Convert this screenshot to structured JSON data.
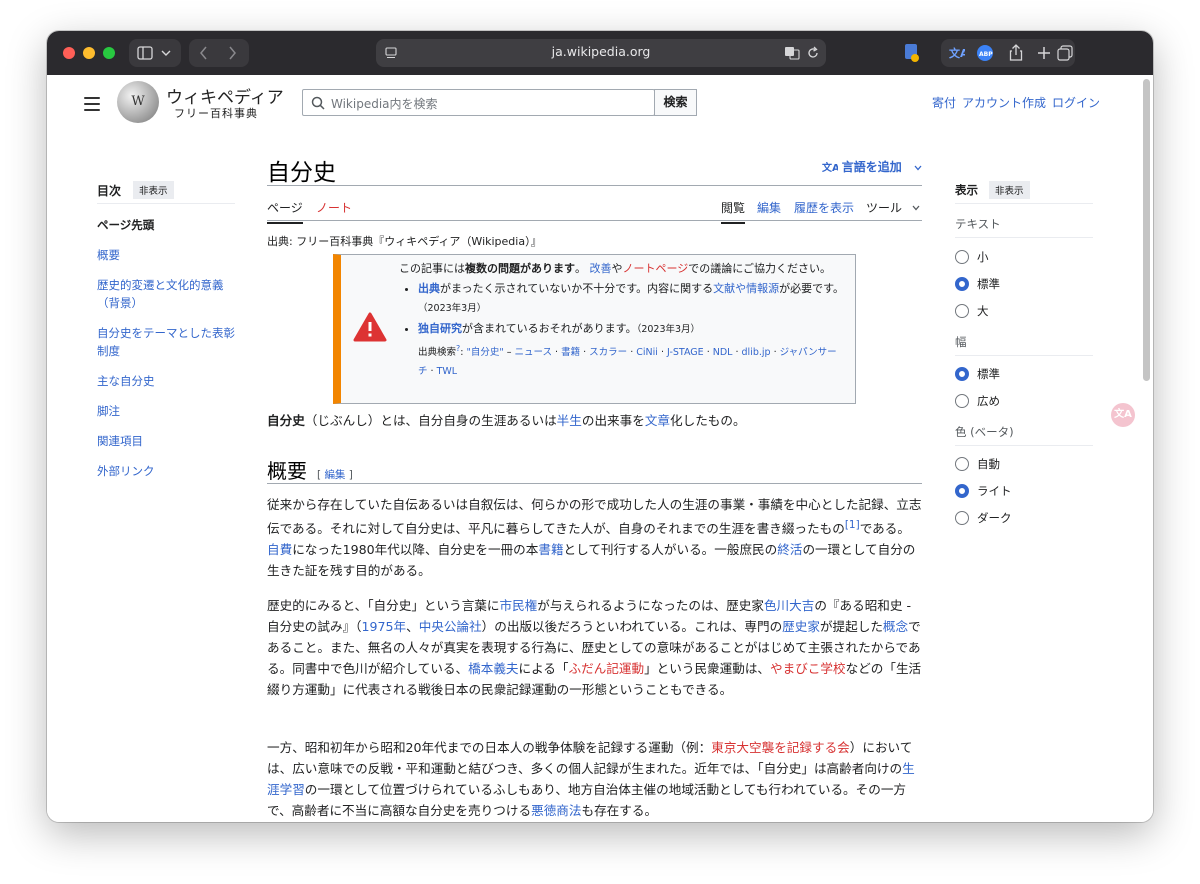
{
  "browser": {
    "url": "ja.wikipedia.org"
  },
  "header": {
    "logo_title": "ウィキペディア",
    "logo_subtitle": "フリー百科事典",
    "search_placeholder": "Wikipedia内を検索",
    "search_button": "検索",
    "links": [
      "寄付",
      "アカウント作成",
      "ログイン"
    ]
  },
  "toc": {
    "title": "目次",
    "hide_label": "非表示",
    "items": [
      "ページ先頭",
      "概要",
      "歴史的変遷と文化的意義（背景）",
      "自分史をテーマとした表彰制度",
      "主な自分史",
      "脚注",
      "関連項目",
      "外部リンク"
    ]
  },
  "article": {
    "title": "自分史",
    "add_languages": "言語を追加",
    "tabs_left": [
      "ページ",
      "ノート"
    ],
    "tabs_right": [
      "閲覧",
      "編集",
      "履歴を表示",
      "ツール"
    ],
    "from_line": "出典: フリー百科事典『ウィキペディア（Wikipedia）』",
    "notice": {
      "line1_a": "この記事には",
      "line1_b": "複数の問題があります",
      "line1_c": "。",
      "line1_d": "改善",
      "line1_e": "や",
      "line1_f": "ノートページ",
      "line1_g": "での議論にご協力ください。",
      "item1_a": "出典",
      "item1_b": "がまったく示されていないか不十分です。内容に関する",
      "item1_c": "文献や情報源",
      "item1_d": "が必要です。",
      "item1_date": "（2023年3月）",
      "item2_a": "独自研究",
      "item2_b": "が含まれているおそれがあります。",
      "item2_date": "（2023年3月）",
      "search_label": "出典検索",
      "search_q": "\"自分史\"",
      "search_sources": [
        "ニュース",
        "書籍",
        "スカラー",
        "CiNii",
        "J-STAGE",
        "NDL",
        "dlib.jp",
        "ジャパンサーチ",
        "TWL"
      ]
    },
    "lead": {
      "a": "自分史",
      "b": "（じぶんし）とは、自分自身の生涯あるいは",
      "c": "半生",
      "d": "の出来事を",
      "e": "文章",
      "f": "化したもの。"
    },
    "section_heading": "概要",
    "edit_label": "編集",
    "para1": {
      "a": "従来から存在していた自伝あるいは自叙伝は、何らかの形で成功した人の生涯の事業・事績を中心とした記録、立志伝である。それに対して自分史は、平凡に暮らしてきた人が、自身のそれまでの生涯を書き綴ったもの",
      "ref": "[1]",
      "b": "である。",
      "c": "自費",
      "d": "になった1980年代以降、自分史を一冊の本",
      "e": "書籍",
      "f": "として刊行する人がいる。一般庶民の",
      "g": "終活",
      "h": "の一環として自分の生きた証を残す目的がある。"
    },
    "para2": {
      "a": "歴史的にみると、「自分史」という言葉に",
      "b": "市民権",
      "c": "が与えられるようになったのは、歴史家",
      "d": "色川大吉",
      "e": "の『ある昭和史 - 自分史の試み』（",
      "f": "1975年",
      "g": "、",
      "h": "中央公論社",
      "i": "）の出版以後だろうといわれている。これは、専門の",
      "j": "歴史家",
      "k": "が提起した",
      "l": "概念",
      "m": "であること。また、無名の人々が真実を表現する行為に、歴史としての意味があることがはじめて主張されたからである。同書中で色川が紹介している、",
      "n": "橋本義夫",
      "o": "による「",
      "p": "ふだん記運動",
      "q": "」という民衆運動は、",
      "r": "やまびこ学校",
      "s": "などの「生活綴り方運動」に代表される戦後日本の民衆記録運動の一形態ということもできる。"
    },
    "para3": {
      "a": "一方、昭和初年から昭和20年代までの日本人の戦争体験を記録する運動（例：",
      "b": "東京大空襲を記録する会",
      "c": "）においては、広い意味での反戦・平和運動と結びつき、多くの個人記録が生まれた。近年では、「自分史」は高齢者向けの",
      "d": "生涯学習",
      "e": "の一環として位置づけられているふしもあり、地方自治体主催の地域活動としても行われている。その一方で、高齢者に不当に高額な自分史を売りつける",
      "f": "悪徳商法",
      "g": "も存在する。"
    }
  },
  "appearance": {
    "title": "表示",
    "hide_label": "非表示",
    "text_label": "テキスト",
    "text_options": [
      "小",
      "標準",
      "大"
    ],
    "text_selected": "標準",
    "width_label": "幅",
    "width_options": [
      "標準",
      "広め"
    ],
    "width_selected": "標準",
    "color_label": "色 (ベータ)",
    "color_options": [
      "自動",
      "ライト",
      "ダーク"
    ],
    "color_selected": "ライト"
  },
  "colors": {
    "link": "#3366cc",
    "redlink": "#d73333",
    "notice_bar": "#f28500",
    "warning_icon": "#dd3333"
  }
}
